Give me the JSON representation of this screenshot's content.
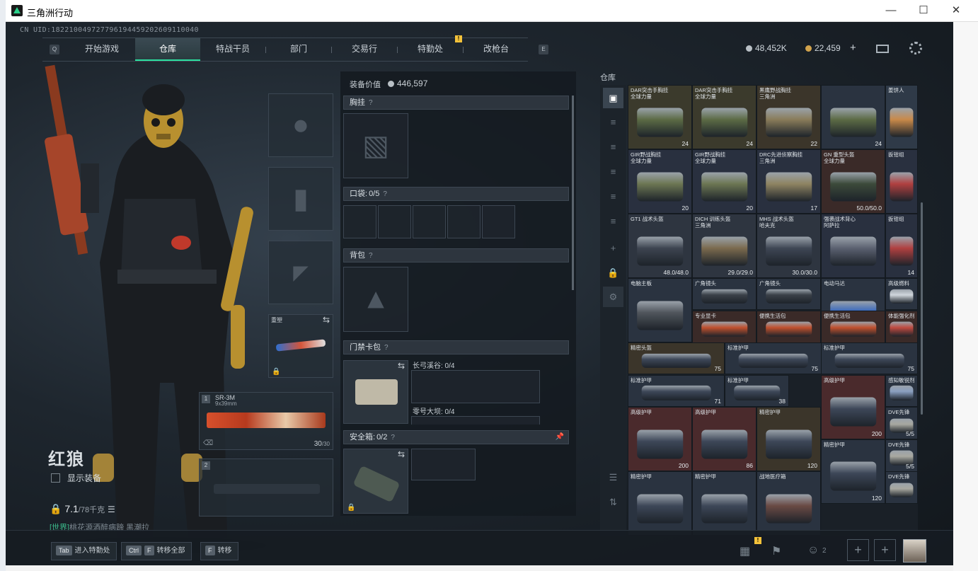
{
  "window": {
    "title": "三角洲行动",
    "min": "—",
    "max": "☐",
    "close": "✕"
  },
  "uid": "CN UID:1822100497277961944592026091100​40",
  "nav": {
    "left_key": "Q",
    "right_key": "E",
    "tabs": [
      "开始游戏",
      "仓库",
      "特战干员",
      "部门",
      "交易行",
      "特勤处",
      "改枪台"
    ],
    "alert": "!"
  },
  "currency": {
    "silver": "48,452K",
    "gold": "22,459",
    "plus": "+"
  },
  "character": {
    "name": "红狼",
    "show_gear": "显示装备",
    "weight": "7.1",
    "weight_max": "/78千克",
    "chat_channel": "[世界]",
    "chat_text": "桃花源酒醉病蹄 黑潮拉"
  },
  "weapons": {
    "slot1": {
      "index": "1",
      "name": "SR-3M",
      "ammo_type": "9x39mm",
      "ammo": "30",
      "ammo_max": "/30"
    },
    "slot2": {
      "index": "2"
    },
    "melee": {
      "label": "重塑"
    }
  },
  "gear": {
    "value_label": "装备价值",
    "value": "446,597",
    "chest_rig": "胸挂",
    "pockets": "口袋:",
    "pockets_count": "0/5",
    "backpack": "背包",
    "keycard": "门禁卡包",
    "key1": "长弓溪谷: 0/4",
    "key2": "零号大坝: 0/4",
    "safebox": "安全箱:",
    "safebox_count": "0/2",
    "help": "?"
  },
  "stash": {
    "title": "仓库",
    "items": [
      {
        "name": "DAR突击手胸挂\n全球力量",
        "count": "24"
      },
      {
        "name": "DAR突击手胸挂\n全球力量",
        "count": "24"
      },
      {
        "name": "黑鹰野战胸挂\n三角洲",
        "count": "22"
      },
      {
        "name": "",
        "count": "24"
      },
      {
        "name": "姜饼人",
        "count": ""
      },
      {
        "name": "GIR野战胸挂\n全球力量",
        "count": "20"
      },
      {
        "name": "GIR野战胸挂\n全球力量",
        "count": "20"
      },
      {
        "name": "DRC先进侦察胸挂\n三角洲",
        "count": "17"
      },
      {
        "name": "GN 重型头盔\n全球力量",
        "count": "50.0/50.0"
      },
      {
        "name": "扳钳组",
        "count": ""
      },
      {
        "name": "强袭战术背心\n阿萨拉",
        "count": ""
      },
      {
        "name": "扳钳组",
        "count": "14"
      },
      {
        "name": "GT1 战术头盔",
        "count": "48.0/48.0"
      },
      {
        "name": "DICH 训练头盔\n三角洲",
        "count": "29.0/29.0"
      },
      {
        "name": "MHS 战术头盔\n哈夫克",
        "count": "30.0/30.0"
      },
      {
        "name": "电动马达",
        "count": ""
      },
      {
        "name": "电脑主板",
        "count": ""
      },
      {
        "name": "广角镜头",
        "count": ""
      },
      {
        "name": "广角镜头",
        "count": ""
      },
      {
        "name": "高级燃料",
        "count": ""
      },
      {
        "name": "专业显卡",
        "count": ""
      },
      {
        "name": "便携生活包",
        "count": ""
      },
      {
        "name": "便携生活包",
        "count": ""
      },
      {
        "name": "体能强化剂",
        "count": ""
      },
      {
        "name": "精密头盔",
        "count": "75"
      },
      {
        "name": "标准护甲",
        "count": "75"
      },
      {
        "name": "标准护甲",
        "count": "75"
      },
      {
        "name": "标准护甲",
        "count": "71"
      },
      {
        "name": "标准护甲",
        "count": "38"
      },
      {
        "name": "高级护甲",
        "count": "200"
      },
      {
        "name": "感知敏锐剂",
        "count": ""
      },
      {
        "name": "高级护甲",
        "count": "200"
      },
      {
        "name": "高级护甲",
        "count": "86"
      },
      {
        "name": "精密护甲",
        "count": "120"
      },
      {
        "name": "DVE先锋",
        "count": "5/5"
      },
      {
        "name": "精密护甲",
        "count": "120"
      },
      {
        "name": "DVE先锋",
        "count": "5/5"
      },
      {
        "name": "精密护甲",
        "count": ""
      },
      {
        "name": "精密护甲",
        "count": ""
      },
      {
        "name": "战地医疗箱",
        "count": ""
      },
      {
        "name": "DVE先锋",
        "count": ""
      }
    ]
  },
  "bottom": {
    "hint1_key": "Tab",
    "hint1": "进入特勤处",
    "hint2_key1": "Ctrl",
    "hint2_key2": "F",
    "hint2": "转移全部",
    "hint3_key": "F",
    "hint3": "转移",
    "friends_count": "2",
    "alert": "!"
  }
}
